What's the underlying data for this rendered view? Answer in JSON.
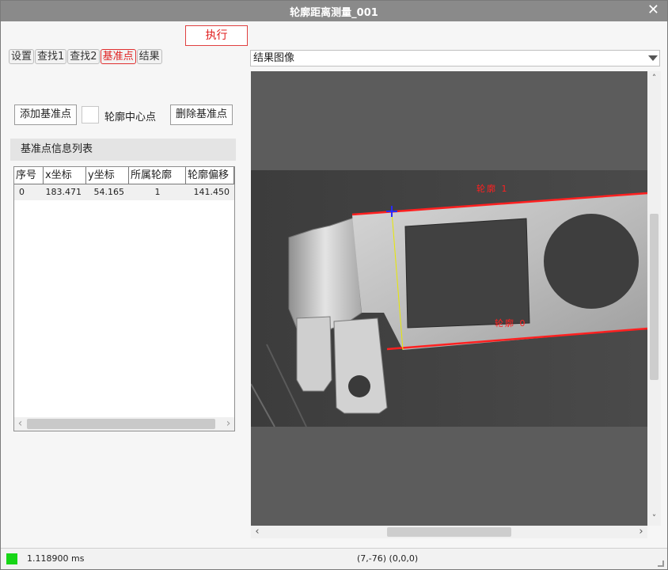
{
  "window": {
    "title": "轮廓距离测量_001",
    "close_glyph": "✕"
  },
  "toolbar": {
    "execute_label": "执行"
  },
  "tabs": [
    {
      "label": "设置",
      "active": false
    },
    {
      "label": "查找1",
      "active": false
    },
    {
      "label": "查找2",
      "active": false
    },
    {
      "label": "基准点",
      "active": true
    },
    {
      "label": "结果",
      "active": false
    }
  ],
  "actions": {
    "add_label": "添加基准点",
    "center_label": "轮廓中心点",
    "delete_label": "删除基准点"
  },
  "list_section": {
    "title": "基准点信息列表"
  },
  "table": {
    "headers": [
      "序号",
      "x坐标",
      "y坐标",
      "所属轮廓",
      "轮廓偏移"
    ],
    "rows": [
      [
        "0",
        "183.471",
        "54.165",
        "1",
        "141.450"
      ]
    ]
  },
  "image_view": {
    "selected": "结果图像",
    "label_contour_1": "轮廓 1",
    "label_contour_0": "轮廓 0",
    "line_color": "#ff2020",
    "marker_color": "#2a2aff",
    "guide_color": "#e8e800"
  },
  "status": {
    "time": "1.118900 ms",
    "coords": "(7,-76)  (0,0,0)",
    "led_color": "#17d617"
  },
  "icons": {
    "close": "close-icon",
    "dropdown": "chevron-down-icon",
    "scroll_left": "chevron-left-icon",
    "scroll_right": "chevron-right-icon",
    "scroll_up": "chevron-up-icon",
    "scroll_down": "chevron-down-icon"
  }
}
